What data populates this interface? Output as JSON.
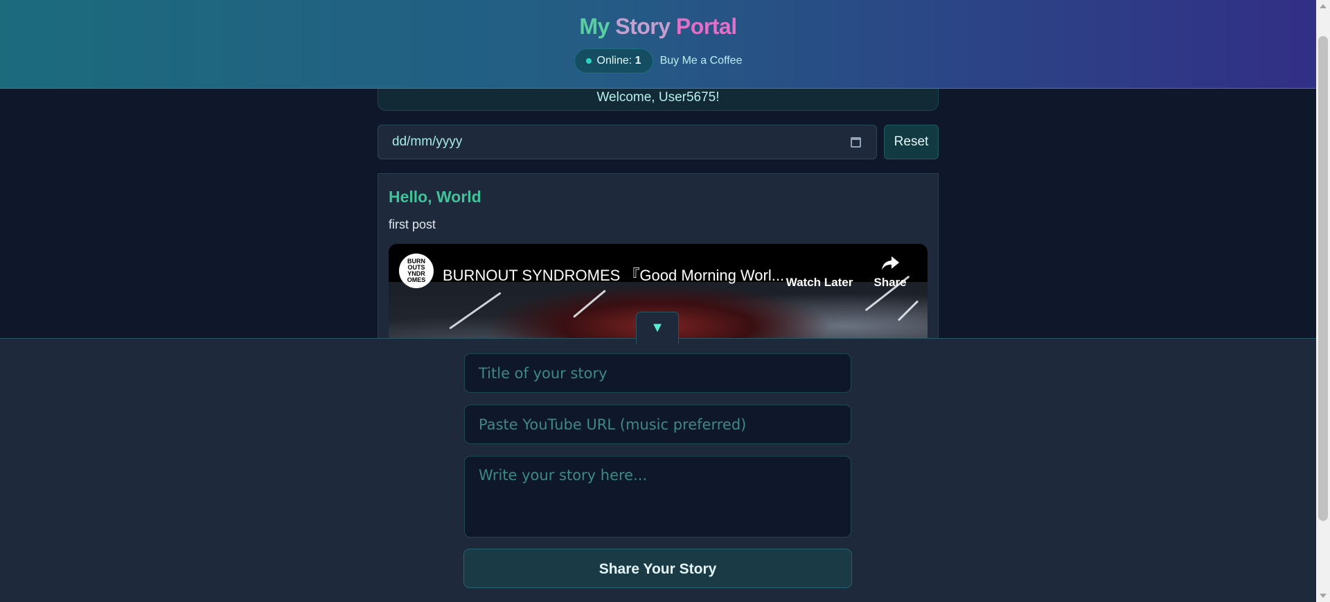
{
  "header": {
    "title_parts": [
      "My",
      "Story",
      "Portal"
    ],
    "online_label": "Online:",
    "online_count": "1",
    "coffee_link": "Buy Me a Coffee"
  },
  "welcome": "Welcome, User5675!",
  "filter": {
    "date_placeholder": "dd/mm/yyyy",
    "reset_label": "Reset"
  },
  "post": {
    "title": "Hello, World",
    "body": "first post",
    "video": {
      "channel_avatar_text": "BURN OUTS YNDR OMES",
      "title": "BURNOUT SYNDROMES 『Good Morning Worl...",
      "watch_later": "Watch Later",
      "share": "Share"
    }
  },
  "form": {
    "toggle_icon": "▼",
    "title_placeholder": "Title of your story",
    "url_placeholder": "Paste YouTube URL (music preferred)",
    "story_placeholder": "Write your story here...",
    "submit_label": "Share Your Story"
  },
  "colors": {
    "accent": "#3fc49a",
    "online_dot": "#2dd4bf",
    "background": "#0f172a",
    "panel": "#1e293b"
  },
  "icons": [
    "calendar-icon",
    "clock-icon",
    "share-arrow-icon",
    "chevron-down-icon"
  ]
}
